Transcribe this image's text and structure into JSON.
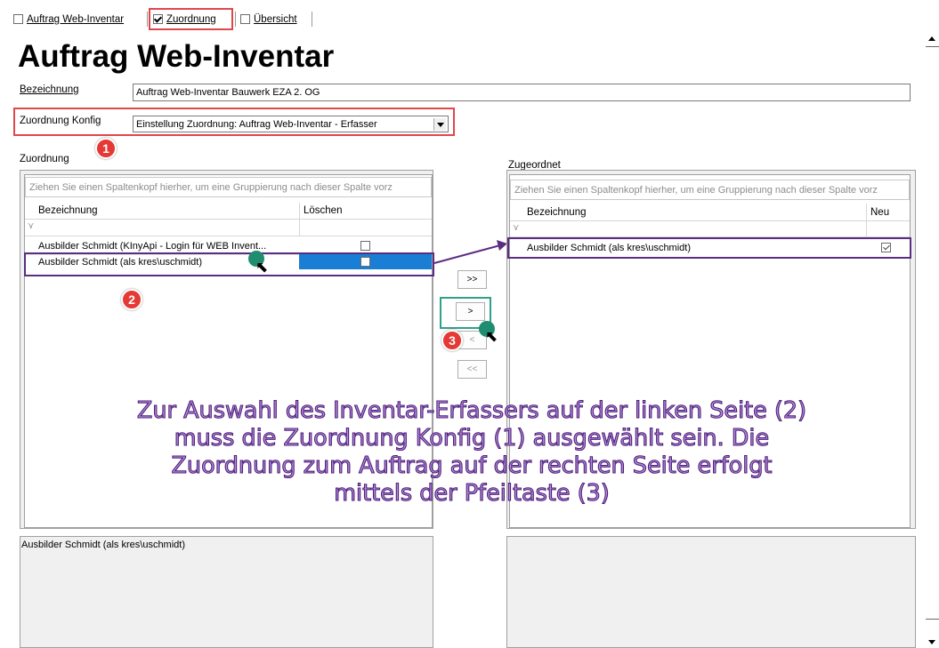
{
  "tabs": [
    {
      "label": "Auftrag Web-Inventar",
      "checked": false
    },
    {
      "label": "Zuordnung",
      "checked": true
    },
    {
      "label": "Übersicht",
      "checked": false
    }
  ],
  "page_title": "Auftrag Web-Inventar",
  "bezeichnung": {
    "label": "Bezeichnung",
    "value": "Auftrag Web-Inventar Bauwerk EZA 2. OG"
  },
  "zuordnung_konfig": {
    "label": "Zuordnung Konfig",
    "value": "Einstellung Zuordnung: Auftrag Web-Inventar - Erfasser"
  },
  "left": {
    "section_label": "Zuordnung",
    "group_hint": "Ziehen Sie einen Spaltenkopf hierher, um eine Gruppierung nach dieser Spalte vorz",
    "columns": [
      "Bezeichnung",
      "Löschen"
    ],
    "rows": [
      {
        "name": "Ausbilder Schmidt (KInyApi - Login für WEB Invent...",
        "checked": false
      },
      {
        "name": "Ausbilder Schmidt (als kres\\uschmidt)",
        "checked": false
      }
    ],
    "detail_text": "Ausbilder Schmidt (als kres\\uschmidt)"
  },
  "right": {
    "section_label": "Zugeordnet",
    "group_hint": "Ziehen Sie einen Spaltenkopf hierher, um eine Gruppierung nach dieser Spalte vorz",
    "columns": [
      "Bezeichnung",
      "Neu"
    ],
    "rows": [
      {
        "name": "Ausbilder Schmidt (als kres\\uschmidt)",
        "checked": true
      }
    ]
  },
  "buttons": {
    "all_right": ">>",
    "one_right": ">",
    "one_left": "<",
    "all_left": "<<"
  },
  "badges": [
    "1",
    "2",
    "3"
  ],
  "annotation": "Zur Auswahl des Inventar-Erfassers auf der linken Seite (2) muss die Zuordnung Konfig (1) ausgewählt sein. Die Zuordnung zum Auftrag auf der rechten Seite erfolgt mittels der Pfeiltaste (3)",
  "colors": {
    "highlight_red": "#e0474c",
    "highlight_purple": "#5b2d82",
    "highlight_green": "#2fa08a",
    "selection_blue": "#1a7fd4",
    "badge_red": "#e53935"
  }
}
